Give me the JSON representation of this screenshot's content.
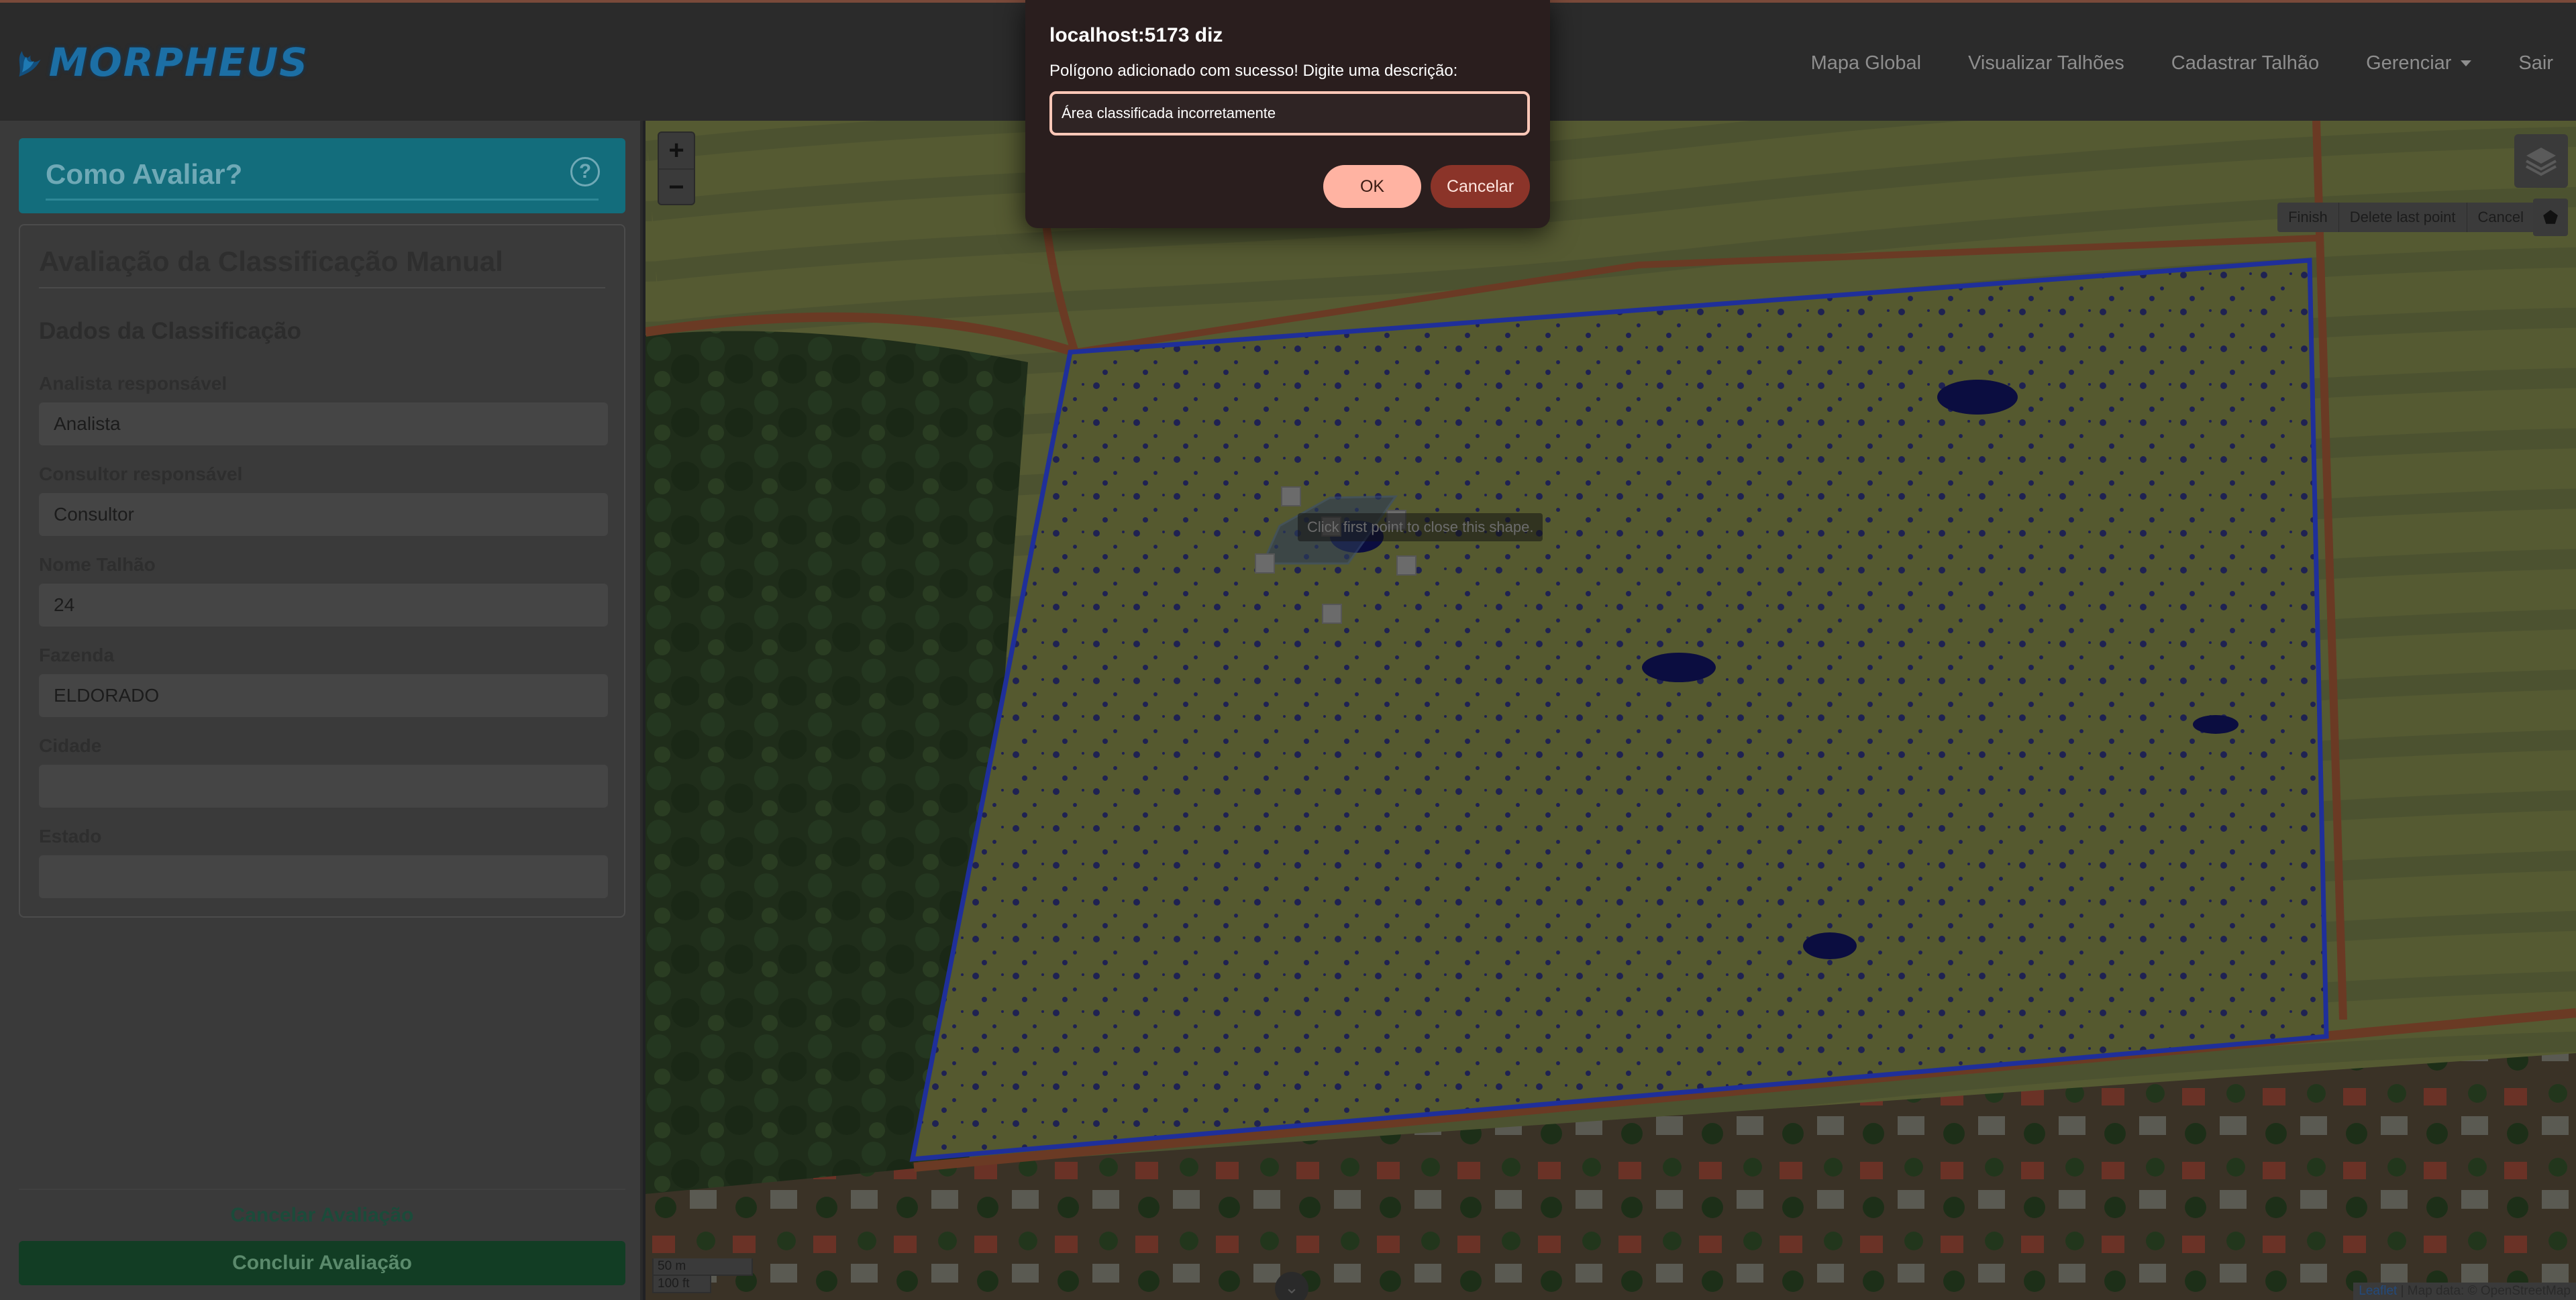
{
  "navbar": {
    "logo_text": "MORPHEUS",
    "links": [
      "Mapa Global",
      "Visualizar Talhões",
      "Cadastrar Talhão",
      "Gerenciar",
      "Sair"
    ]
  },
  "help": {
    "title": "Como Avaliar?",
    "icon": "?"
  },
  "form": {
    "title": "Avaliação da Classificação Manual",
    "section": "Dados da Classificação",
    "fields": [
      {
        "label": "Analista responsável",
        "value": "Analista"
      },
      {
        "label": "Consultor responsável",
        "value": "Consultor"
      },
      {
        "label": "Nome Talhão",
        "value": "24"
      },
      {
        "label": "Fazenda",
        "value": "ELDORADO"
      },
      {
        "label": "Cidade",
        "value": ""
      },
      {
        "label": "Estado",
        "value": ""
      }
    ]
  },
  "actions": {
    "cancel": "Cancelar Avaliação",
    "conclude": "Concluir Avaliação"
  },
  "map": {
    "zoom_in": "+",
    "zoom_out": "−",
    "draw_actions": [
      "Finish",
      "Delete last point",
      "Cancel"
    ],
    "polygon_icon": "⬟",
    "tooltip": "Click first point to close this shape.",
    "scale_m": "50 m",
    "scale_ft": "100 ft",
    "attribution_link": "Leaflet",
    "attribution_text": " | Map data: © OpenStreetMap",
    "bottom_handle": "⌄"
  },
  "dialog": {
    "title": "localhost:5173 diz",
    "message": "Polígono adicionado com sucesso! Digite uma descrição:",
    "input_value": "Área classificada incorretamente",
    "ok": "OK",
    "cancel": "Cancelar"
  },
  "colors": {
    "navbar": "#2b2b2b",
    "help_card": "#136d7c",
    "conclude_button": "#123d24",
    "dialog_bg": "#2a1e1e",
    "ok_button": "#ffb3a2",
    "cancel_button": "#8b3429",
    "field_boundary": "#1f2f9a"
  }
}
